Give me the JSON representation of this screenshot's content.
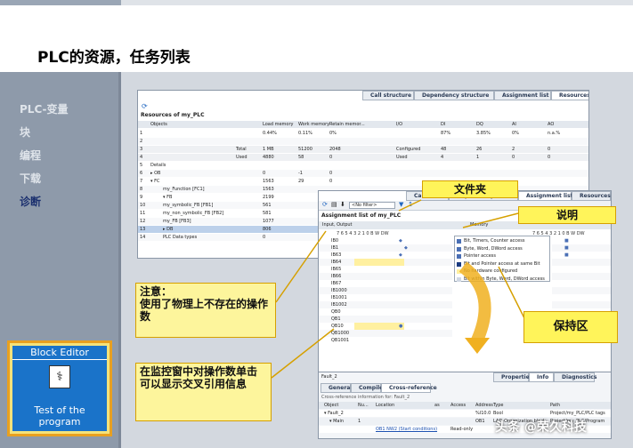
{
  "page_title": "PLC的资源，任务列表",
  "nav": [
    "PLC-变量",
    "块",
    "编程",
    "下载",
    "诊断"
  ],
  "badge": {
    "header": "Block Editor",
    "footer": "Test of the program"
  },
  "res": {
    "tabs": [
      "Call structure",
      "Dependency structure",
      "Assignment list",
      "Resources"
    ],
    "header": "Resources of my_PLC",
    "cols": [
      "Objects",
      "Load memory",
      "Work memory",
      "Retain memor...",
      "I/O",
      "DI",
      "DQ",
      "AI",
      "AO"
    ],
    "rows": [
      [
        "1",
        "",
        "0.44%",
        "0.11%",
        "0%",
        "",
        "87%",
        "3.85%",
        "0%",
        "n.a.%"
      ],
      [
        "2",
        "",
        "",
        "",
        "",
        "",
        "",
        "",
        "",
        ""
      ],
      [
        "3",
        "Total",
        "1 MB",
        "51200",
        "2048",
        "Configured",
        "48",
        "26",
        "2",
        "0"
      ],
      [
        "4",
        "Used",
        "4880",
        "58",
        "0",
        "Used",
        "4",
        "1",
        "0",
        "0"
      ],
      [
        "5",
        "Details",
        "",
        "",
        "",
        "",
        "",
        "",
        "",
        ""
      ],
      [
        "6",
        "▸ OB",
        "0",
        "-1",
        "0",
        "",
        "",
        "",
        "",
        ""
      ],
      [
        "7",
        "▾ FC",
        "1563",
        "29",
        "0",
        "",
        "",
        "",
        "",
        ""
      ],
      [
        "8",
        "my_Function [FC1]",
        "1563",
        "",
        "",
        "",
        "",
        "",
        "",
        ""
      ],
      [
        "9",
        "▾ FB",
        "2199",
        "",
        "",
        "",
        "",
        "",
        "",
        ""
      ],
      [
        "10",
        "my_symbolic_FB [FB1]",
        "561",
        "",
        "",
        "",
        "",
        "",
        "",
        ""
      ],
      [
        "11",
        "my_non_symbolic_FB [FB2]",
        "581",
        "",
        "",
        "",
        "",
        "",
        "",
        ""
      ],
      [
        "12",
        "my_FB [FB3]",
        "1077",
        "",
        "",
        "",
        "",
        "",
        "",
        ""
      ],
      [
        "13",
        "▸ DB",
        "806",
        "",
        "",
        "",
        "",
        "",
        "",
        ""
      ],
      [
        "14",
        "PLC Data types",
        "0",
        "",
        "",
        "",
        "",
        "",
        "",
        ""
      ]
    ]
  },
  "asg": {
    "tabs": [
      "Call structure",
      "Dependency structure",
      "Assignment list",
      "Resources"
    ],
    "filter": "<No filter>",
    "header": "Assignment list of my_PLC",
    "left_head": "Input, Output",
    "bits": "7 6 5 4 3 2 1 0 B W DW",
    "addresses": [
      "IB0",
      "IB1",
      "IB63",
      "IB64",
      "IB65",
      "IB66",
      "IB67",
      "IB1000",
      "IB1001",
      "IB1002",
      "QB0",
      "QB1",
      "QB10",
      "QB1000",
      "QB1001"
    ],
    "right_head": "Memory",
    "legend": [
      "Bit, Timers, Counter access",
      "Byte, Word, DWord access",
      "Pointer access",
      "Bit and Pointer access at same Bit",
      "No hardware configured",
      "Bit within Byte, Word, DWord access"
    ]
  },
  "inspector": {
    "title": "Fault_2",
    "tabs": [
      "Properties",
      "Info",
      "Diagnostics"
    ],
    "subtabs": [
      "General",
      "Compile",
      "Cross-reference"
    ],
    "caption": "Cross-reference information for: Fault_2",
    "cols": [
      "Object",
      "Nu...",
      "Location",
      "as",
      "Access",
      "Address",
      "Type",
      "Path"
    ],
    "rows": [
      [
        "▾ Fault_2",
        "",
        "",
        "",
        "",
        "%I10.0",
        "Bool",
        "Project/my_PLC/PLC tags"
      ],
      [
        "▾ Main",
        "1",
        "",
        "",
        "",
        "OB1",
        "LAD-Organization block",
        "Project/my_PLC/Program"
      ],
      [
        "",
        "",
        "OB1 NW2 (Start conditions)",
        "",
        "Read-only",
        "",
        "",
        ""
      ]
    ]
  },
  "callouts": {
    "folder": "文件夹",
    "explain": "说明",
    "note": "注意：\n使用了物理上不存在的操作数",
    "retain": "保持区",
    "monitor": "在监控窗中对操作数单击可以显示交叉引用信息"
  },
  "watermark": "头条 @荣久科技"
}
